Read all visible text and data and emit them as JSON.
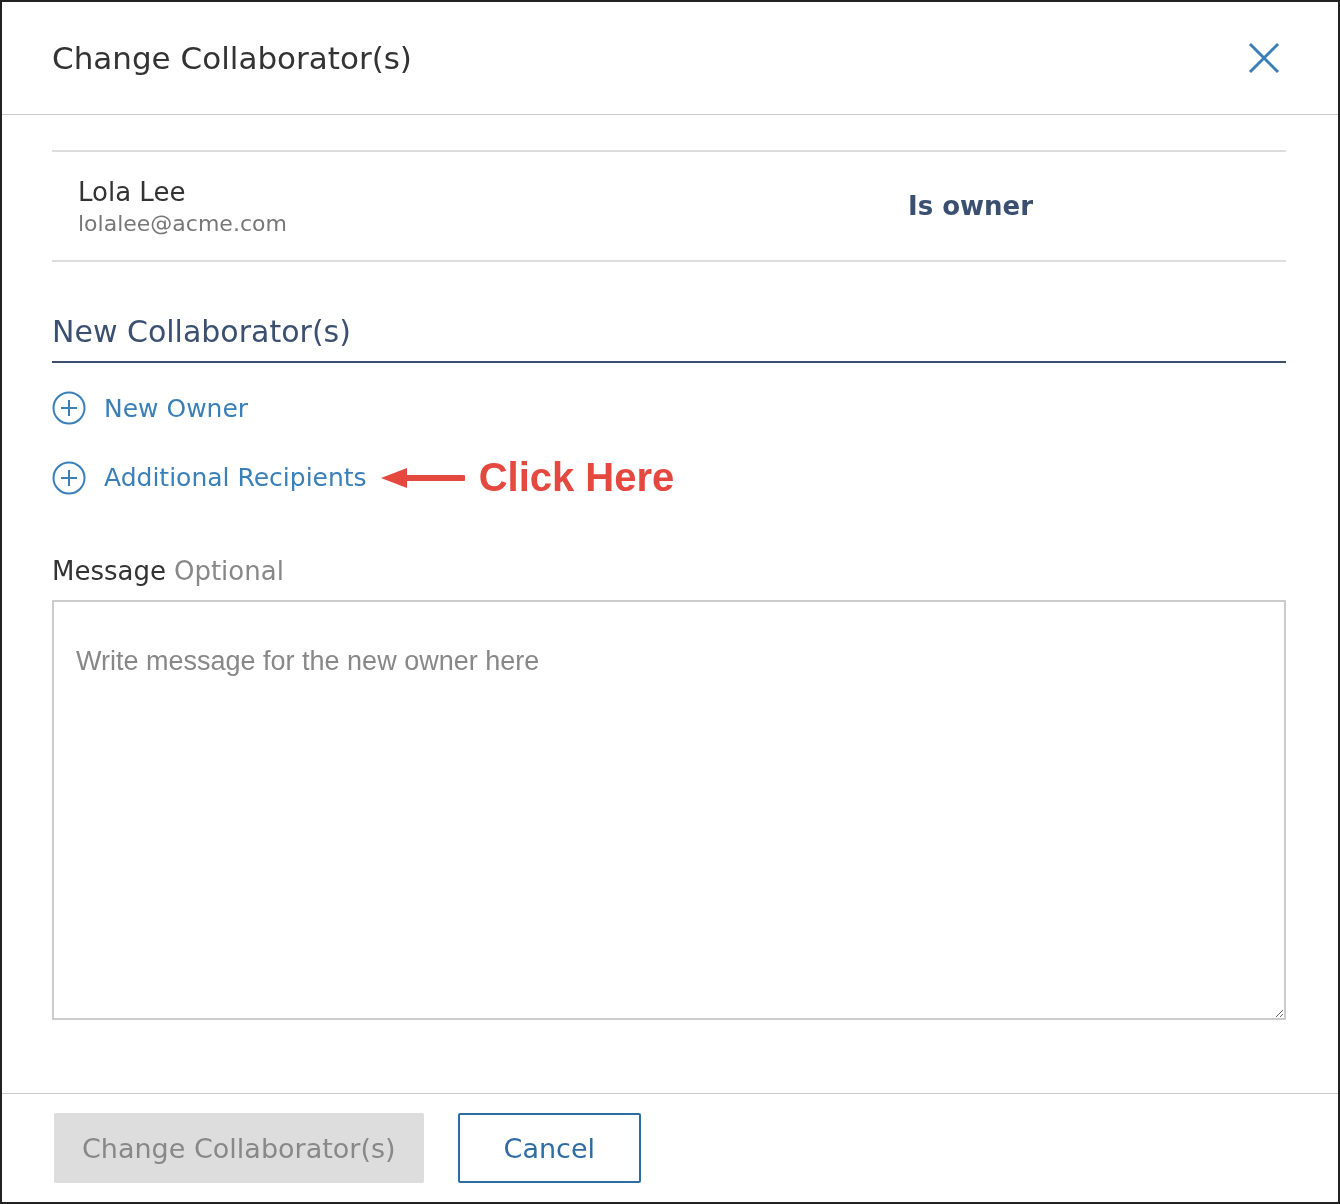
{
  "dialog": {
    "title": "Change Collaborator(s)"
  },
  "current_owner": {
    "name": "Lola Lee",
    "email": "lolalee@acme.com",
    "role": "Is owner"
  },
  "new_collaborators": {
    "heading": "New Collaborator(s)",
    "actions": [
      {
        "label": "New Owner"
      },
      {
        "label": "Additional Recipients",
        "annotation": "Click Here"
      }
    ]
  },
  "message": {
    "label": "Message",
    "hint": "Optional",
    "placeholder": "Write message for the new owner here"
  },
  "buttons": [
    {
      "label": "Change Collaborator(s)",
      "kind": "primary",
      "disabled": true
    },
    {
      "label": "Cancel",
      "kind": "secondary",
      "disabled": false
    }
  ]
}
